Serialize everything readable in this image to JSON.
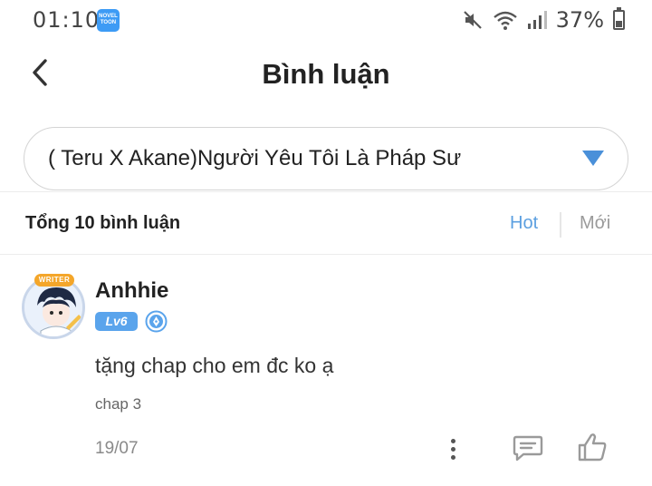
{
  "status_bar": {
    "time": "01:10",
    "app_badge": "NOVEL TOON",
    "battery_text": "37%",
    "battery_level": 0.37,
    "icons": [
      "mute-icon",
      "wifi-icon",
      "signal-icon",
      "battery-icon"
    ]
  },
  "header": {
    "title": "Bình luận",
    "back_icon": "chevron-left-icon"
  },
  "chapter_select": {
    "value": "( Teru X Akane)Người Yêu Tôi Là Pháp Sư",
    "arrow_icon": "caret-down-icon"
  },
  "sort_bar": {
    "total_label": "Tổng 10 bình luận",
    "hot_label": "Hot",
    "new_label": "Mới",
    "active": "Hot"
  },
  "comments": [
    {
      "username": "Anhhie",
      "writer_tag": "WRITER",
      "level": "Lv6",
      "text": "tặng chap cho em đc ko ạ",
      "chapter": "chap 3",
      "date": "19/07"
    }
  ],
  "colors": {
    "accent": "#5b9fe0",
    "level_badge": "#5aa4ec",
    "select_arrow": "#4a90d9",
    "writer_tag": "#f4a62a"
  }
}
